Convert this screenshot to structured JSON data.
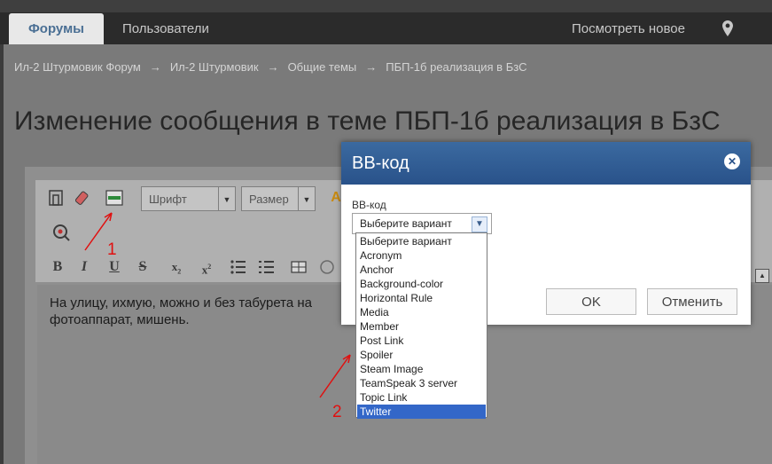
{
  "nav": {
    "tab_forums": "Форумы",
    "tab_users": "Пользователи",
    "view_new": "Посмотреть новое"
  },
  "breadcrumbs": [
    "Ил-2 Штурмовик Форум",
    "Ил-2 Штурмовик",
    "Общие темы",
    "ПБП-1б реализация в БзС"
  ],
  "page_title": "Изменение сообщения в теме ПБП-1б реализация в БзС",
  "toolbar": {
    "font_select": "Шрифт",
    "size_select": "Размер"
  },
  "editor_text": "На улицу, ихмую, можно и без табурета на фотоаппарат, мишень.",
  "dialog": {
    "title": "BB-код",
    "field_label": "BB-код",
    "select_value": "Выберите вариант",
    "ok_label": "OK",
    "cancel_label": "Отменить"
  },
  "dropdown_options": [
    "Выберите вариант",
    "Acronym",
    "Anchor",
    "Background-color",
    "Horizontal Rule",
    "Media",
    "Member",
    "Post Link",
    "Spoiler",
    "Steam Image",
    "TeamSpeak 3 server",
    "Topic Link",
    "Twitter"
  ],
  "dropdown_selected_index": 12,
  "annotations": {
    "label_1": "1",
    "label_2": "2"
  },
  "colors": {
    "accent": "#29528a",
    "selection": "#3367c8",
    "annotation": "#e01010"
  }
}
